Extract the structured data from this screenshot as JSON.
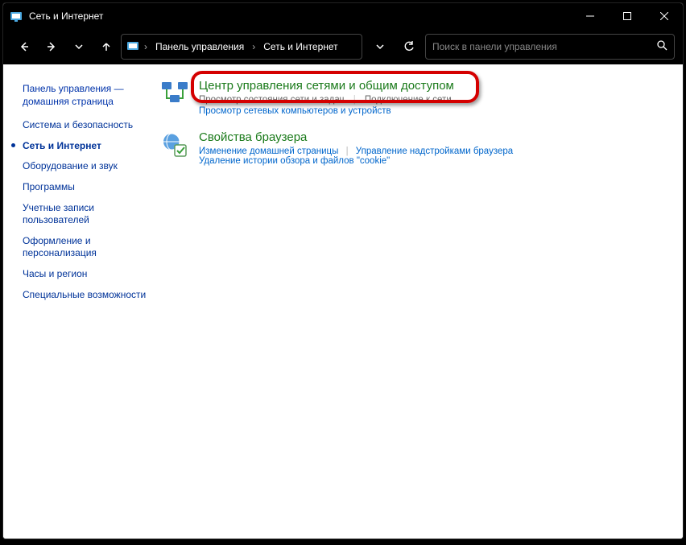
{
  "titlebar": {
    "title": "Сеть и Интернет"
  },
  "nav": {
    "crumb_root": "Панель управления",
    "crumb_current": "Сеть и Интернет"
  },
  "search": {
    "placeholder": "Поиск в панели управления"
  },
  "sidebar": {
    "home": "Панель управления — домашняя страница",
    "items": [
      "Система и безопасность",
      "Сеть и Интернет",
      "Оборудование и звук",
      "Программы",
      "Учетные записи пользователей",
      "Оформление и персонализация",
      "Часы и регион",
      "Специальные возможности"
    ],
    "active_index": 1
  },
  "categories": [
    {
      "title": "Центр управления сетями и общим доступом",
      "subtitle_parts": [
        "Просмотр состояния сети и задач",
        "Подключение к сети"
      ],
      "links": [
        "Просмотр сетевых компьютеров и устройств"
      ]
    },
    {
      "title": "Свойства браузера",
      "links": [
        "Изменение домашней страницы",
        "Управление надстройками браузера",
        "Удаление истории обзора и файлов \"cookie\""
      ]
    }
  ]
}
